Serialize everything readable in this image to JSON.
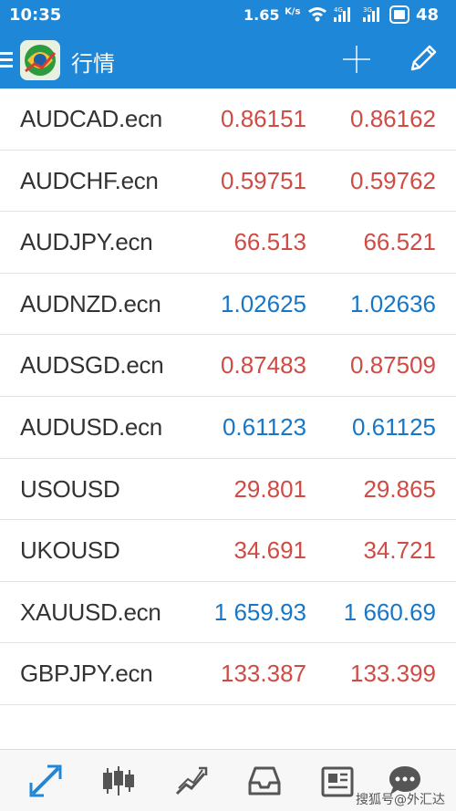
{
  "status_bar": {
    "time": "10:35",
    "speed_value": "1.65",
    "speed_unit": "K/s",
    "battery": "48"
  },
  "app_bar": {
    "title": "行情",
    "icons": [
      "menu-icon",
      "app-logo",
      "add-icon",
      "edit-icon"
    ]
  },
  "colors": {
    "brand": "#1f87d8",
    "price_down": "#cf4b44",
    "price_up": "#1677c9",
    "nav_active": "#1f87d8"
  },
  "quotes": [
    {
      "symbol": "AUDCAD.ecn",
      "bid": "0.86151",
      "ask": "0.86162",
      "direction": "down"
    },
    {
      "symbol": "AUDCHF.ecn",
      "bid": "0.59751",
      "ask": "0.59762",
      "direction": "down"
    },
    {
      "symbol": "AUDJPY.ecn",
      "bid": "66.513",
      "ask": "66.521",
      "direction": "down"
    },
    {
      "symbol": "AUDNZD.ecn",
      "bid": "1.02625",
      "ask": "1.02636",
      "direction": "up"
    },
    {
      "symbol": "AUDSGD.ecn",
      "bid": "0.87483",
      "ask": "0.87509",
      "direction": "down"
    },
    {
      "symbol": "AUDUSD.ecn",
      "bid": "0.61123",
      "ask": "0.61125",
      "direction": "up"
    },
    {
      "symbol": "USOUSD",
      "bid": "29.801",
      "ask": "29.865",
      "direction": "down"
    },
    {
      "symbol": "UKOUSD",
      "bid": "34.691",
      "ask": "34.721",
      "direction": "down"
    },
    {
      "symbol": "XAUUSD.ecn",
      "bid": "1 659.93",
      "ask": "1 660.69",
      "direction": "up"
    },
    {
      "symbol": "GBPJPY.ecn",
      "bid": "133.387",
      "ask": "133.399",
      "direction": "down"
    }
  ],
  "bottom_nav": {
    "items": [
      "quotes-icon",
      "chart-icon",
      "trade-icon",
      "history-icon",
      "news-icon",
      "chat-icon"
    ],
    "active": "quotes-icon"
  },
  "watermark": "搜狐号@外汇达人"
}
